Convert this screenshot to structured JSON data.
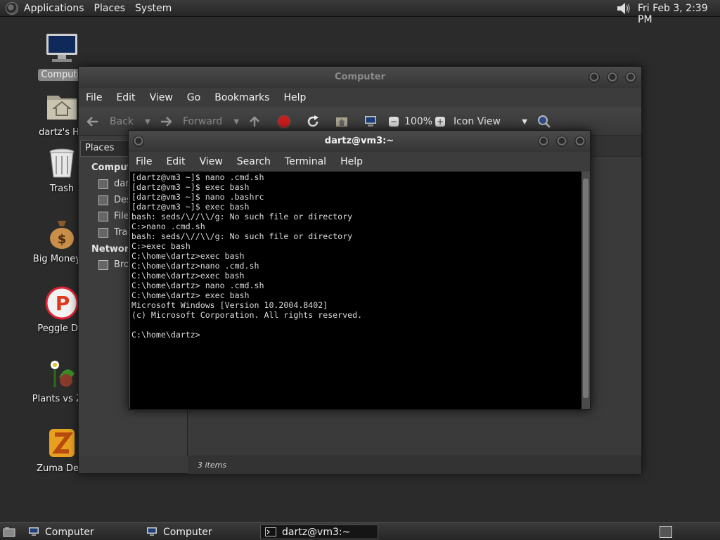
{
  "top_panel": {
    "menus": [
      "Applications",
      "Places",
      "System"
    ],
    "clock": "Fri Feb  3,  2:39 PM"
  },
  "desktop_icons": [
    {
      "name": "computer",
      "label": "Compute"
    },
    {
      "name": "home",
      "label": "dartz's Ho"
    },
    {
      "name": "trash",
      "label": "Trash"
    },
    {
      "name": "big-money",
      "label": "Big Money D"
    },
    {
      "name": "peggle",
      "label": "Peggle Del"
    },
    {
      "name": "plants-vs-zombies",
      "label": "Plants vs Zor"
    },
    {
      "name": "zuma",
      "label": "Zuma Delu"
    }
  ],
  "file_manager": {
    "title": "Computer",
    "menu": [
      "File",
      "Edit",
      "View",
      "Go",
      "Bookmarks",
      "Help"
    ],
    "toolbar": {
      "back": "Back",
      "forward": "Forward",
      "zoom": "100%",
      "view_mode": "Icon View"
    },
    "sidepane": {
      "header": "Places",
      "section_computer": "Comput",
      "items": [
        "dar",
        "Des",
        "File",
        "Tra"
      ],
      "section_network": "Network",
      "network_items": [
        "Bro"
      ]
    },
    "status": "3 items"
  },
  "terminal": {
    "title": "dartz@vm3:~",
    "menu": [
      "File",
      "Edit",
      "View",
      "Search",
      "Terminal",
      "Help"
    ],
    "lines": [
      "[dartz@vm3 ~]$ nano .cmd.sh",
      "[dartz@vm3 ~]$ exec bash",
      "[dartz@vm3 ~]$ nano .bashrc",
      "[dartz@vm3 ~]$ exec bash",
      "bash: seds/\\//\\\\/g: No such file or directory",
      "C:>nano .cmd.sh",
      "bash: seds/\\//\\\\/g: No such file or directory",
      "C:>exec bash",
      "C:\\home\\dartz>exec bash",
      "C:\\home\\dartz>nano .cmd.sh",
      "C:\\home\\dartz>exec bash",
      "C:\\home\\dartz> nano .cmd.sh",
      "C:\\home\\dartz> exec bash",
      "Microsoft Windows [Version 10.2004.8402]",
      "(c) Microsoft Corporation. All rights reserved.",
      "",
      "C:\\home\\dartz>"
    ]
  },
  "taskbar": {
    "tasks": [
      {
        "label": "Computer",
        "active": false
      },
      {
        "label": "Computer",
        "active": false
      },
      {
        "label": "dartz@vm3:~",
        "active": true
      }
    ]
  }
}
